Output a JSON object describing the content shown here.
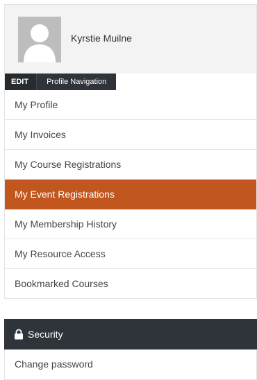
{
  "profile": {
    "name": "Kyrstie Muilne",
    "avatar_icon": "user-silhouette-icon"
  },
  "edit_bar": {
    "edit_label": "EDIT",
    "section_label": "Profile Navigation"
  },
  "nav": {
    "items": [
      {
        "label": "My Profile"
      },
      {
        "label": "My Invoices"
      },
      {
        "label": "My Course Registrations"
      },
      {
        "label": "My Event Registrations"
      },
      {
        "label": "My Membership History"
      },
      {
        "label": "My Resource Access"
      },
      {
        "label": "Bookmarked Courses"
      }
    ],
    "active_index": 3,
    "active_color": "#c1561f"
  },
  "security": {
    "title": "Security",
    "icon": "lock-icon",
    "items": [
      {
        "label": "Change password"
      }
    ]
  }
}
